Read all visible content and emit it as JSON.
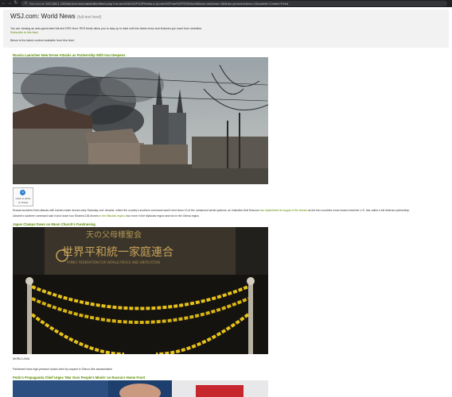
{
  "browser": {
    "security_label": "Not secure",
    "url": "192.168.1.195/full-text-rss/makefulltextfeed.php?url=sec%3A%2F%2Ffeeds.a.dj.com%2Frss%2FRSSWorldNews.xml&max=3&links=preserve&exc=1&submit=Create+Feed"
  },
  "header": {
    "title": "WSJ.com: World News",
    "subtitle": "(full-text feed)",
    "description": "You are viewing an auto-generated full-text RSS feed. RSS feeds allow you to stay up to date with the latest news and features you want from websites.",
    "subscribe_link": "Subscribe to this feed.",
    "latest_note": "Below is the latest content available from this feed."
  },
  "articles": [
    {
      "title": "Russia Launches New Drone Attacks as Partnership With Iran Deepens",
      "listen_label": "Listen to article",
      "listen_duration": "(1 minute)",
      "body_before": "Russia launched fresh attacks with Iranian-made drones early Saturday over Ukraine, where the country's southern command said it shot down 10 of the unmanned aerial systems, an indication that Moscow ",
      "body_link": "has replenished its supply of the drones",
      "body_after": " as the two countries move toward what the U.S. has called a full defense partnership.",
      "body2_before": "Ukraine's southern command said it shot down four Shahed-136 drones ",
      "body2_link": "in the Mikolaiv region",
      "body2_after": ", four more in the Mykolaiv region and two in the Odesa region."
    },
    {
      "title": "Japan Clamps Down on Moon Church's Fundraising",
      "photo_sign_line1": "天の父母様聖会",
      "photo_sign_line2": "世界平和統一家庭連合",
      "photo_sign_line3": "FAMILY FEDERATION FOR WORLD PEACE AND UNIFICATION",
      "caption_credit": "WORLD ASIA",
      "caption": "Parliament bans high-pressure tactics cited by suspect in Shinzo Abe assassination"
    },
    {
      "title": "Putin's Propaganda Chief Urges 'War Over People's Minds' on Russia's Home Front"
    }
  ]
}
